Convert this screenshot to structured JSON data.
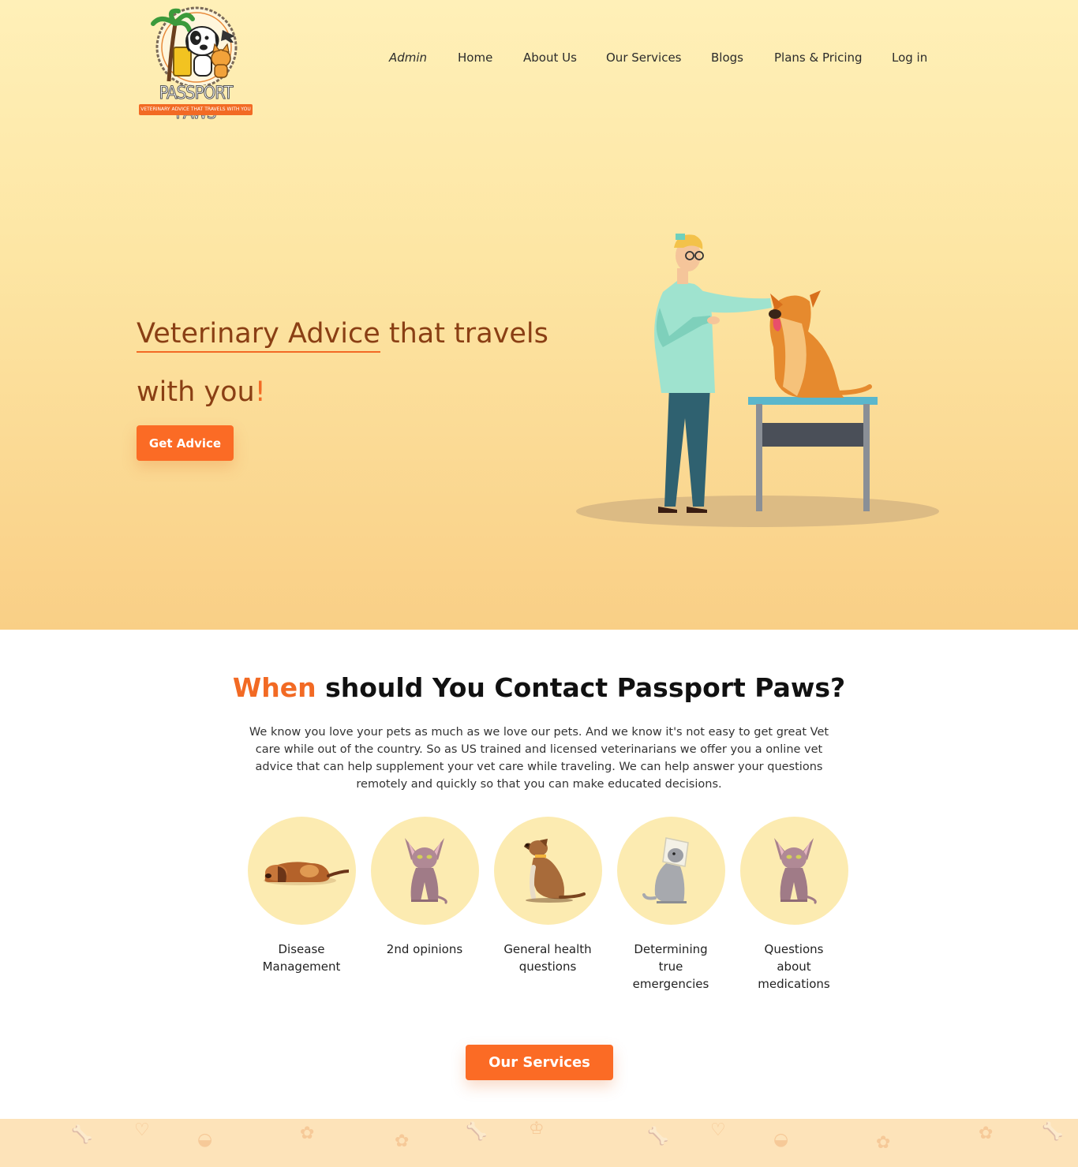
{
  "brand": {
    "name": "PASSPORT PAWS",
    "tagline": "VETERINARY ADVICE THAT TRAVELS WITH YOU"
  },
  "nav": {
    "admin": "Admin",
    "home": "Home",
    "about": "About Us",
    "services": "Our Services",
    "blogs": "Blogs",
    "pricing": "Plans & Pricing",
    "login": "Log in"
  },
  "hero": {
    "title_underlined": "Veterinary Advice",
    "title_rest": " that travels",
    "title_line2": "with you",
    "title_bang": "!",
    "cta": "Get Advice"
  },
  "contact": {
    "title_accent": "When",
    "title_rest": " should You Contact Passport Paws?",
    "intro": "We know you love your pets as much as we love our pets. And we know it's not easy to get great Vet care while out of the country. So as US trained and licensed veterinarians we offer you a online vet advice that can help supplement your vet care while traveling. We can help answer your questions remotely and quickly so that you can make educated decisions.",
    "cards": [
      {
        "label": "Disease Management",
        "icon": "sleeping-dog-icon"
      },
      {
        "label": "2nd opinions",
        "icon": "sphynx-cat-icon"
      },
      {
        "label": "General health questions",
        "icon": "sitting-dog-icon"
      },
      {
        "label": "Determining true emergencies",
        "icon": "cat-cone-icon"
      },
      {
        "label": "Questions about medications",
        "icon": "sphynx-cat-icon"
      }
    ],
    "cta": "Our Services"
  },
  "colors": {
    "accent": "#f26a24",
    "button": "#fb6b25",
    "hero_title": "#8a3f14",
    "circle": "#fcebb1"
  }
}
